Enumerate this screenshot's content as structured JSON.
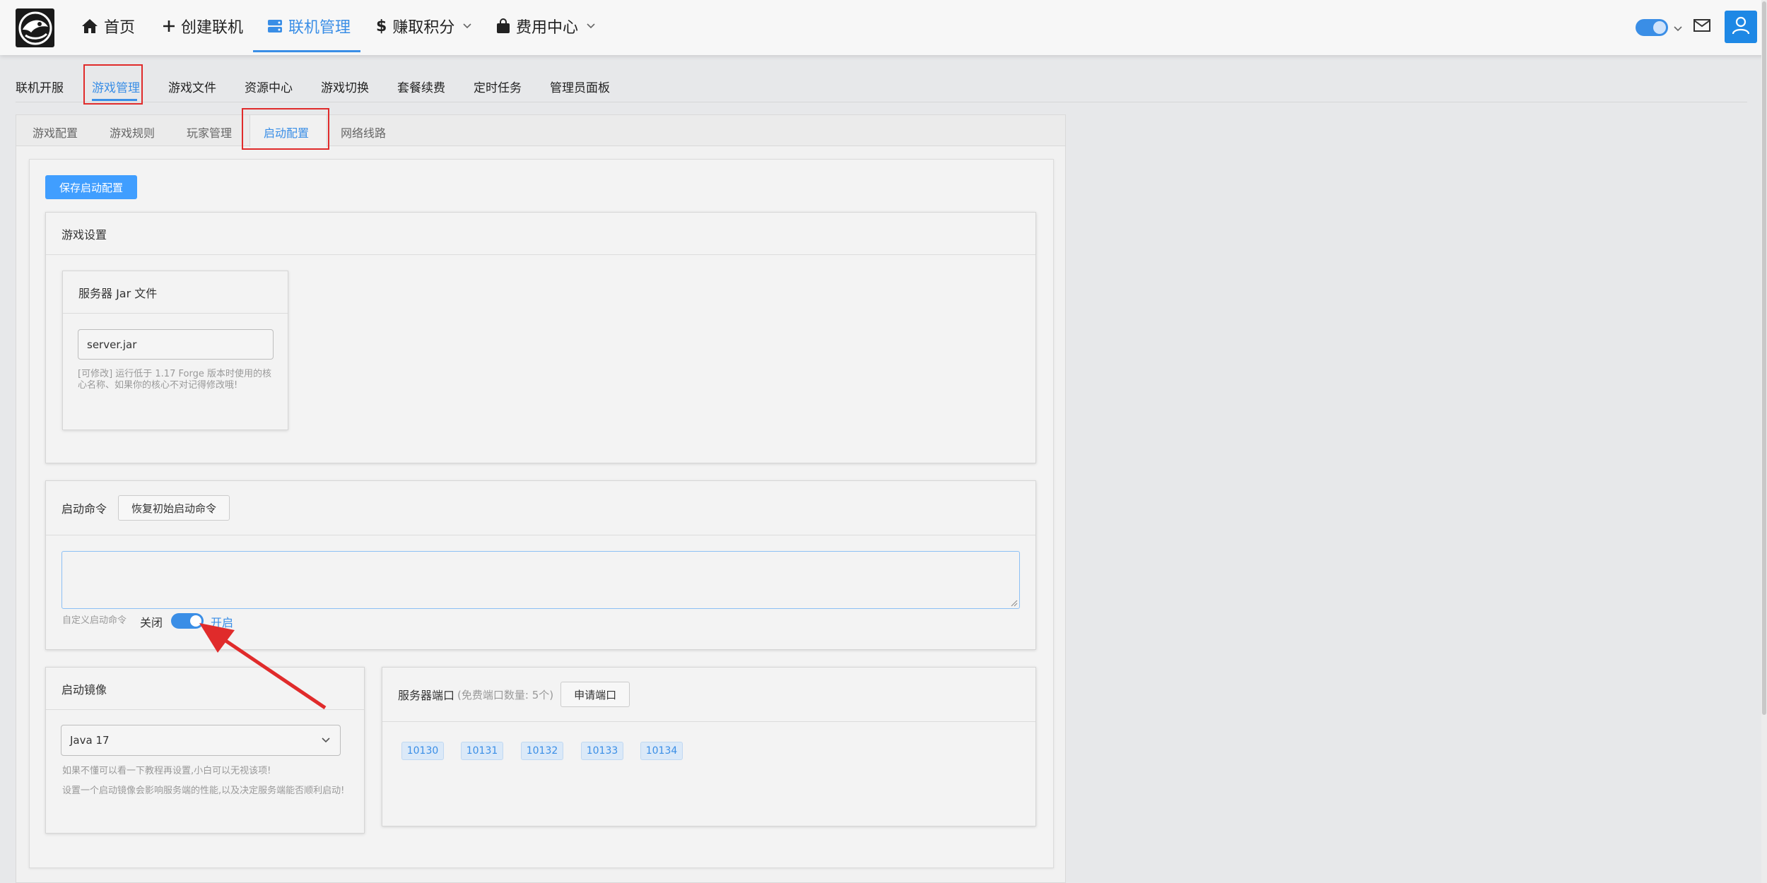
{
  "nav": {
    "home": "首页",
    "create": "创建联机",
    "manage": "联机管理",
    "earn": "赚取积分",
    "fees": "费用中心"
  },
  "subnav": [
    "联机开服",
    "游戏管理",
    "游戏文件",
    "资源中心",
    "游戏切换",
    "套餐续费",
    "定时任务",
    "管理员面板"
  ],
  "tabs": [
    "游戏配置",
    "游戏规则",
    "玩家管理",
    "启动配置",
    "网络线路"
  ],
  "save_button": "保存启动配置",
  "game_settings": {
    "title": "游戏设置",
    "jar_card_title": "服务器 Jar 文件",
    "jar_value": "server.jar",
    "jar_hint": "[可修改] 运行低于 1.17 Forge 版本时使用的核心名称、如果你的核心不对记得修改哦!"
  },
  "launch_command": {
    "title": "启动命令",
    "reset_button": "恢复初始启动命令",
    "custom_label": "自定义启动命令",
    "off_label": "关闭",
    "on_label": "开启",
    "custom_enabled": true
  },
  "image": {
    "title": "启动镜像",
    "selected": "Java 17",
    "hint1": "如果不懂可以看一下教程再设置,小白可以无视该项!",
    "hint2": "设置一个启动镜像会影响服务端的性能,以及决定服务端能否顺利启动!"
  },
  "ports": {
    "title": "服务器端口",
    "subtitle": "(免费端口数量: 5个)",
    "apply_button": "申请端口",
    "list": [
      "10130",
      "10131",
      "10132",
      "10133",
      "10134"
    ]
  },
  "colors": {
    "accent": "#3a8ee6",
    "annotation": "#e02b2b"
  }
}
